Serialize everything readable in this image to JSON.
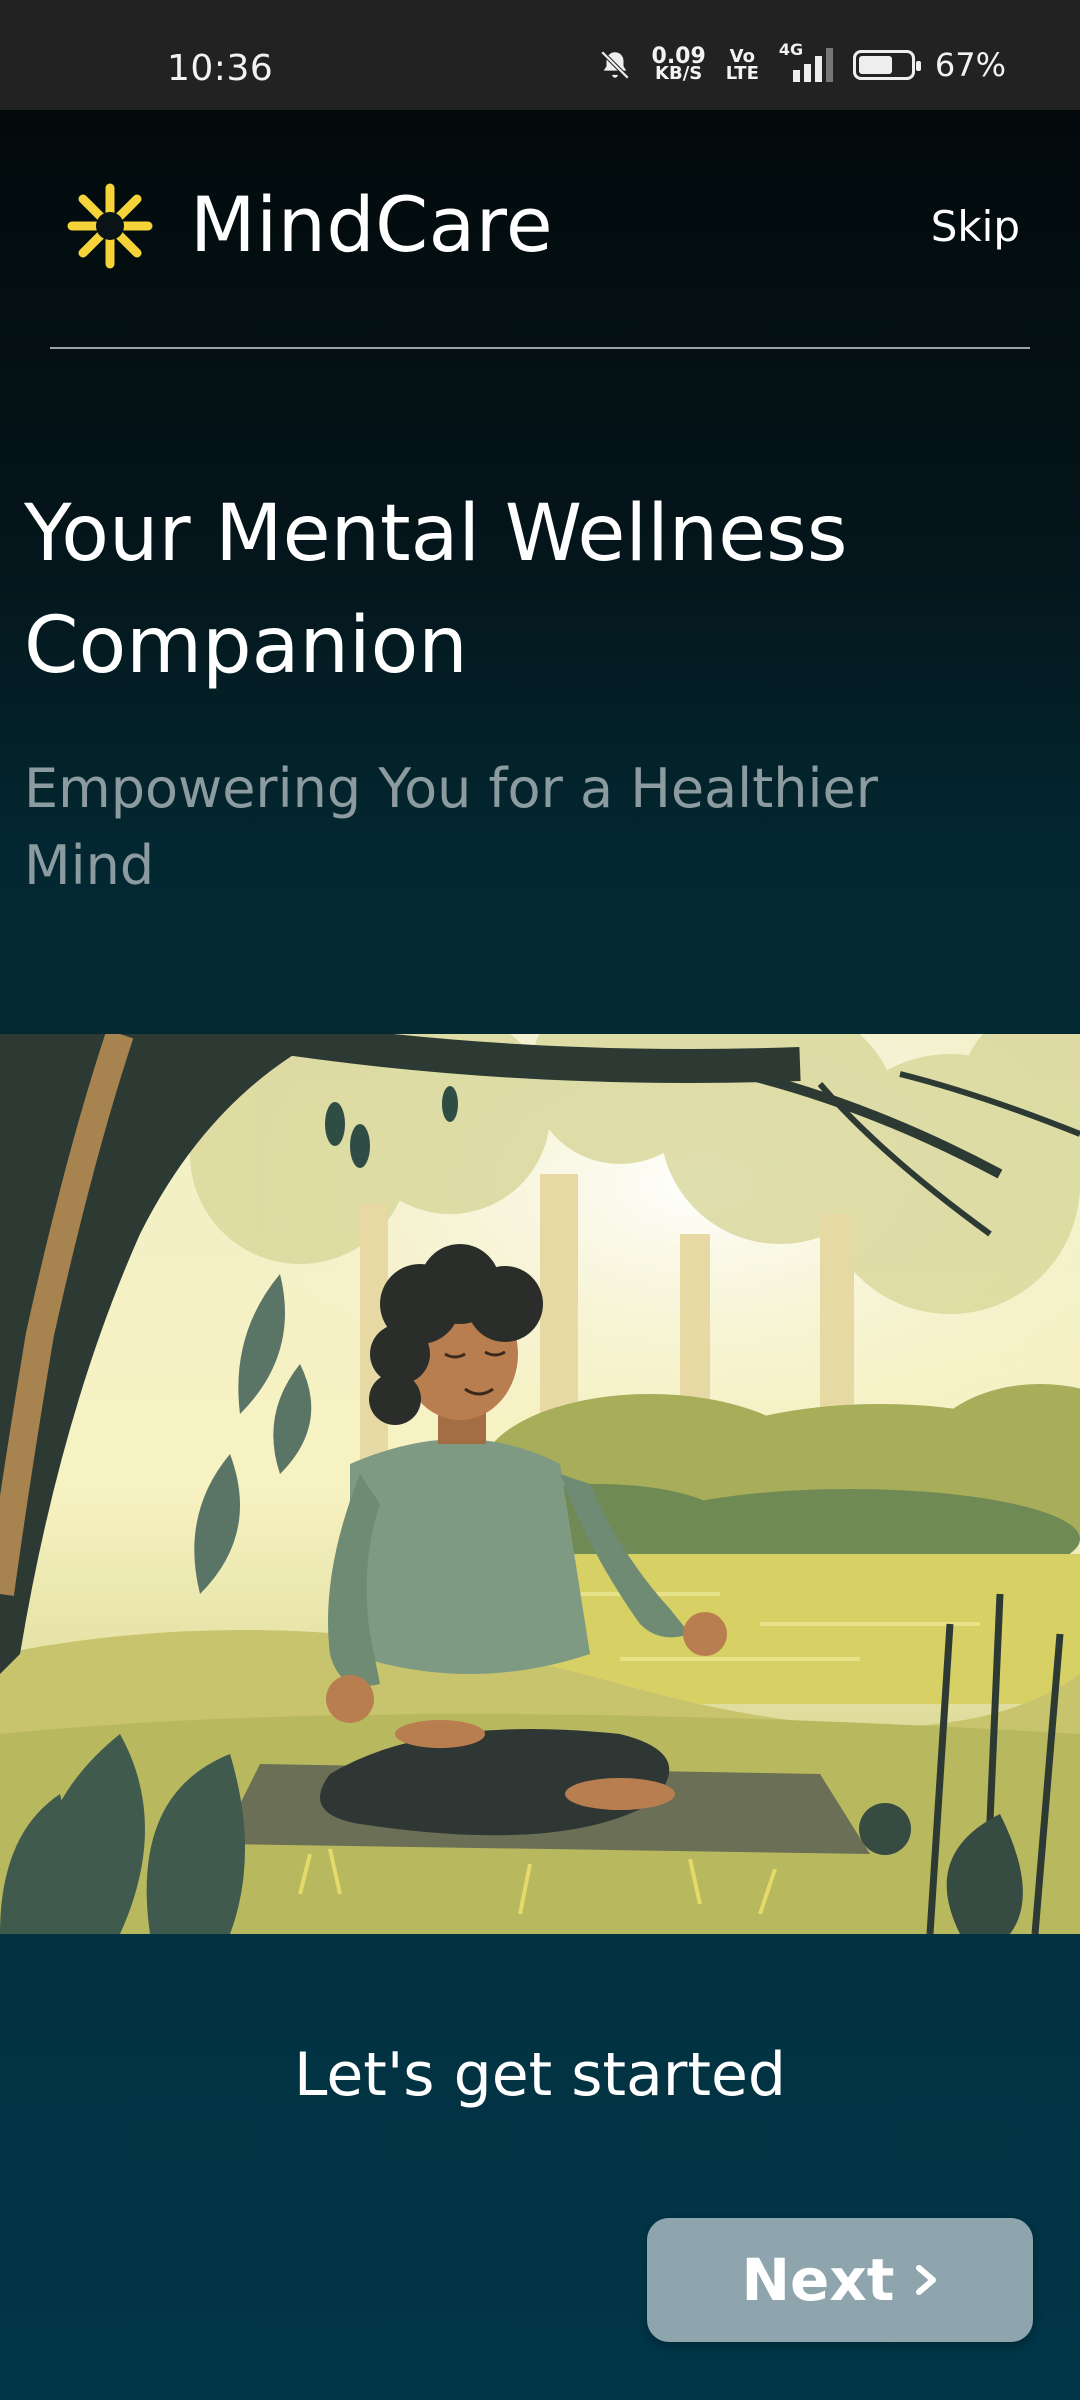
{
  "status_bar": {
    "time": "10:36",
    "net_speed_value": "0.09",
    "net_speed_unit": "KB/S",
    "volte_top": "Vo",
    "volte_bottom": "LTE",
    "network": "4G",
    "battery_percent": "67%",
    "battery_level": 0.67
  },
  "header": {
    "app_name": "MindCare",
    "skip_label": "Skip",
    "logo_icon": "asterisk-flower-icon",
    "accent_color": "#f7d33a"
  },
  "onboarding": {
    "title": "Your Mental Wellness Companion",
    "subtitle": "Empowering You for a Healthier Mind",
    "illustration": "woman-meditating-in-forest-illustration",
    "cta_text": "Let's get started",
    "next_label": "Next"
  }
}
